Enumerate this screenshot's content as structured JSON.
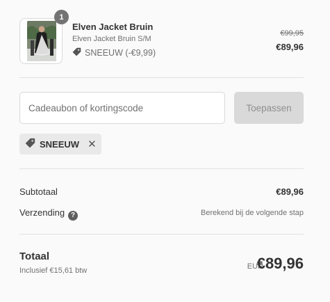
{
  "cart": {
    "item": {
      "quantity": "1",
      "name": "Elven Jacket Bruin",
      "variant": "Elven Jacket Bruin S/M",
      "discount_label": "SNEEUW (-€9,99)",
      "original_price": "€99,95",
      "price": "€89,96"
    }
  },
  "discount": {
    "placeholder": "Cadeaubon of kortingscode",
    "apply_label": "Toepassen",
    "applied_code": "SNEEUW",
    "remove_glyph": "✕"
  },
  "summary": {
    "subtotal_label": "Subtotaal",
    "subtotal_value": "€89,96",
    "shipping_label": "Verzending",
    "shipping_value": "Berekend bij de volgende stap",
    "help_glyph": "?"
  },
  "total": {
    "label": "Totaal",
    "tax_note": "Inclusief €15,61 btw",
    "currency": "EUR",
    "value": "€89,96"
  },
  "icons": {
    "tag": "tag-icon",
    "help": "question-circle-icon",
    "close": "close-icon"
  },
  "colors": {
    "background": "#fafafa",
    "text": "#333333",
    "muted": "#707070",
    "button_disabled": "#d9d9d9",
    "chip": "#e9e9e9",
    "badge": "#737373"
  }
}
